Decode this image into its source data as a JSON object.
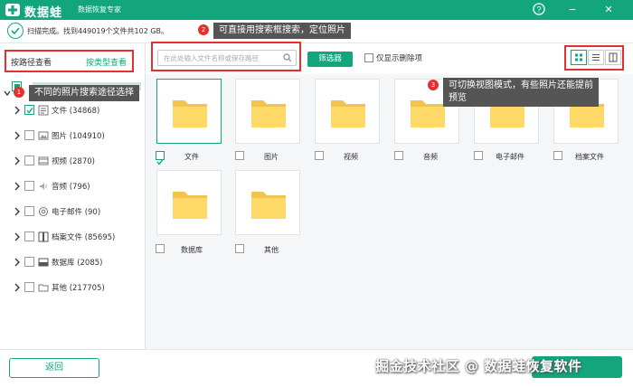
{
  "app": {
    "brand": "数据蛙",
    "subtitle": "数据恢复专家",
    "brand_color": "#13a67d"
  },
  "window": {
    "help_icon": "?",
    "minimize_icon": "−",
    "close_icon": "✕"
  },
  "scan": {
    "status_text": "扫描完成。找到449019个文件共102 GB。"
  },
  "sidebar": {
    "tab_path": "按路径查看",
    "tab_type": "按类型查看",
    "items": [
      {
        "label": "文件 (34868)",
        "checked": true,
        "icon": "document-icon"
      },
      {
        "label": "图片 (104910)",
        "checked": false,
        "icon": "image-icon"
      },
      {
        "label": "视频 (2870)",
        "checked": false,
        "icon": "video-icon"
      },
      {
        "label": "音频 (796)",
        "checked": false,
        "icon": "audio-icon"
      },
      {
        "label": "电子邮件 (90)",
        "checked": false,
        "icon": "email-icon"
      },
      {
        "label": "档案文件 (85695)",
        "checked": false,
        "icon": "archive-icon"
      },
      {
        "label": "数据库 (2085)",
        "checked": false,
        "icon": "database-icon"
      },
      {
        "label": "其他 (217705)",
        "checked": false,
        "icon": "other-folder-icon"
      }
    ]
  },
  "toolbar": {
    "search_placeholder": "在此处输入文件名称或保存路径",
    "filter_label": "筛选器",
    "deleted_only_label": "仅显示删除项"
  },
  "grid": {
    "items": [
      {
        "label": "文件",
        "checked": true,
        "selected": true
      },
      {
        "label": "图片",
        "checked": false,
        "selected": false
      },
      {
        "label": "视频",
        "checked": false,
        "selected": false
      },
      {
        "label": "音频",
        "checked": false,
        "selected": false
      },
      {
        "label": "电子邮件",
        "checked": false,
        "selected": false
      },
      {
        "label": "档案文件",
        "checked": false,
        "selected": false
      },
      {
        "label": "数据库",
        "checked": false,
        "selected": false
      },
      {
        "label": "其他",
        "checked": false,
        "selected": false
      }
    ]
  },
  "callouts": {
    "c1_num": "1",
    "c1_text": "不同的照片搜索途径选择",
    "c2_num": "2",
    "c2_text": "可直接用搜索框搜索，定位照片",
    "c3_num": "3",
    "c3_line1": "可切换视图模式，有些照片还能提前",
    "c3_line2": "预览"
  },
  "footer": {
    "back_label": "返回",
    "watermark": "掘金技术社区 @ 数据蛙恢复软件"
  }
}
